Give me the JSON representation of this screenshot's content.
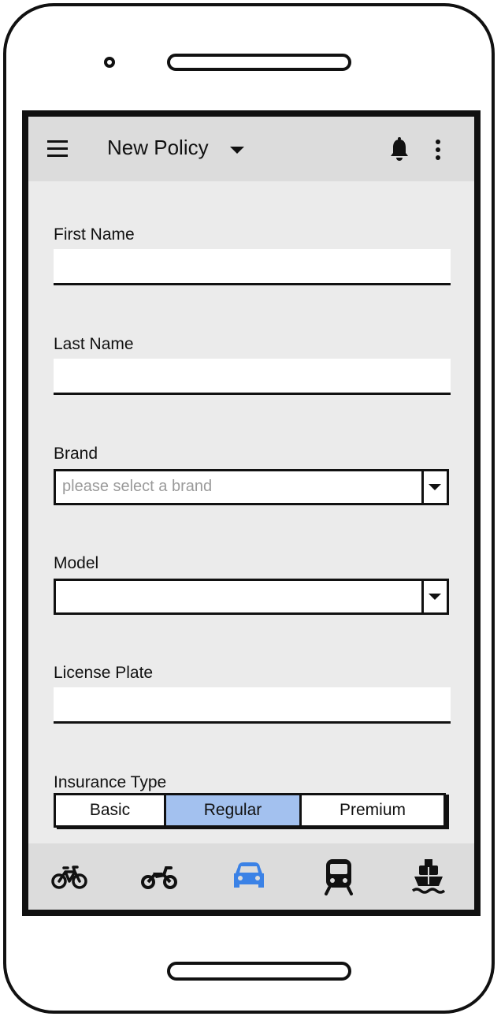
{
  "app_bar": {
    "title": "New Policy",
    "icons": {
      "menu": "menu-icon",
      "title_dropdown": "chevron-down-icon",
      "notifications": "bell-icon",
      "more": "more-vertical-icon"
    }
  },
  "form": {
    "first_name": {
      "label": "First Name",
      "value": ""
    },
    "last_name": {
      "label": "Last Name",
      "value": ""
    },
    "brand": {
      "label": "Brand",
      "placeholder": "please select a brand"
    },
    "model": {
      "label": "Model",
      "value": ""
    },
    "license_plate": {
      "label": "License Plate",
      "value": ""
    },
    "insurance_type": {
      "label": "Insurance Type",
      "options": [
        "Basic",
        "Regular",
        "Premium"
      ],
      "selected": "Regular"
    }
  },
  "bottom_nav": {
    "items": [
      {
        "icon": "bicycle-icon",
        "active": false
      },
      {
        "icon": "motorcycle-icon",
        "active": false
      },
      {
        "icon": "car-icon",
        "active": true
      },
      {
        "icon": "train-icon",
        "active": false
      },
      {
        "icon": "ship-icon",
        "active": false
      }
    ],
    "active_color": "#3b82e6",
    "inactive_color": "#111111"
  }
}
